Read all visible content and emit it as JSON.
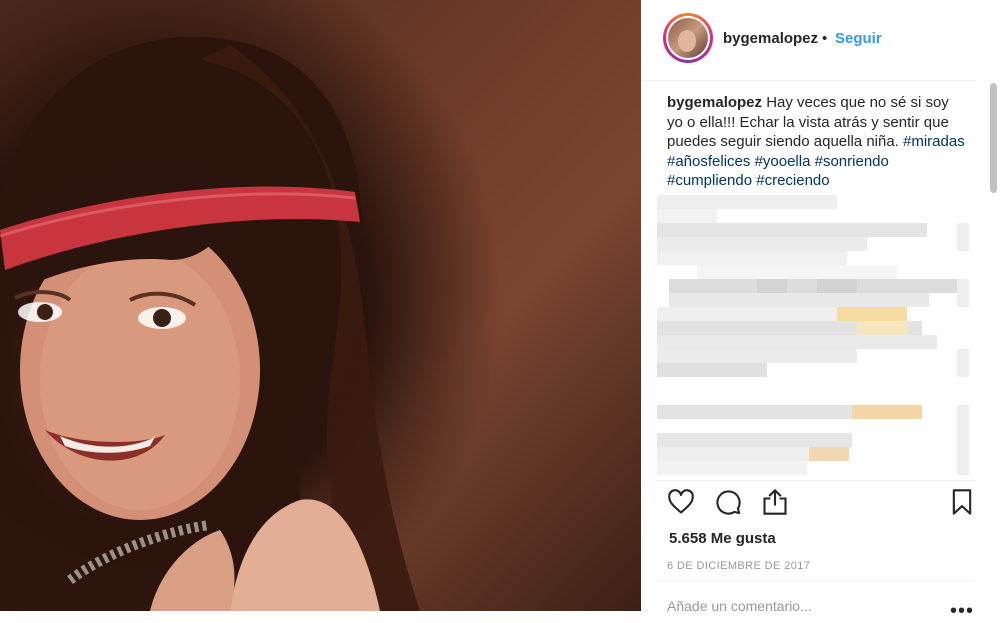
{
  "post": {
    "username": "bygemalopez",
    "separator": "•",
    "follow_label": "Seguir",
    "photo_alt": "Vintage photo of a young girl with a red headband"
  },
  "caption": {
    "username": "bygemalopez",
    "text": "Hay veces que no sé si soy yo o ella!!! Echar la vista atrás y sentir que puedes seguir siendo aquella niña.",
    "hashtags": [
      "#miradas",
      "#añosfelices",
      "#yooella",
      "#sonriendo",
      "#cumpliendo",
      "#creciendo"
    ]
  },
  "actions": {
    "like_icon": "heart-icon",
    "comment_icon": "comment-icon",
    "share_icon": "share-icon",
    "save_icon": "bookmark-icon"
  },
  "stats": {
    "likes": "5.658 Me gusta",
    "date": "6 DE DICIEMBRE DE 2017"
  },
  "comment_box": {
    "placeholder": "Añade un comentario...",
    "more_icon": "ellipsis-icon"
  },
  "colors": {
    "link": "#3897f0",
    "hashtag": "#003569",
    "headband": "#c8353f"
  }
}
